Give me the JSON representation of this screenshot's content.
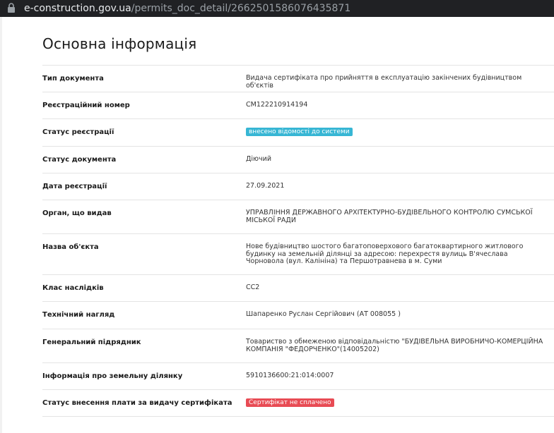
{
  "browser": {
    "url_host": "e-construction.gov.ua",
    "url_path": "/permits_doc_detail/2662501586076435871"
  },
  "page": {
    "title": "Основна інформація",
    "rows": [
      {
        "label": "Тип документа",
        "value": "Видача сертифіката про прийняття в експлуатацію закінчених будівництвом об'єктів"
      },
      {
        "label": "Реєстраційний номер",
        "value": "СМ122210914194"
      },
      {
        "label": "Статус реєстрації",
        "value": "внесено відомості до системи"
      },
      {
        "label": "Статус документа",
        "value": "Діючий"
      },
      {
        "label": "Дата реєстрації",
        "value": "27.09.2021"
      },
      {
        "label": "Орган, що видав",
        "value": "УПРАВЛІННЯ ДЕРЖАВНОГО АРХІТЕКТУРНО-БУДІВЕЛЬНОГО КОНТРОЛЮ СУМСЬКОЇ МІСЬКОЇ РАДИ"
      },
      {
        "label": "Назва об'єкта",
        "value": "Нове будівництво шостого багатоповерхового багатоквартирного житлового будинку на земельній ділянці за адресою: перехрестя вулиць В'ячеслава Чорновола (вул. Калініна) та Першотравнева в м. Суми"
      },
      {
        "label": "Клас наслідків",
        "value": "СС2"
      },
      {
        "label": "Технічний нагляд",
        "value": "Шапаренко Руслан Сергійович (АТ 008055 )"
      },
      {
        "label": "Генеральний підрядник",
        "value": "Товариство з обмеженою відповідальністю \"БУДІВЕЛЬНА ВИРОБНИЧО-КОМЕРЦІЙНА КОМПАНІЯ \"ФЕДОРЧЕНКО\"(14005202)"
      },
      {
        "label": "Інформація про земельну ділянку",
        "value": "5910136600:21:014:0007"
      },
      {
        "label": "Статус внесення плати за видачу сертифіката",
        "value": "Сертифікат не сплачено"
      }
    ]
  },
  "colors": {
    "badge_info": "#37b6d4",
    "badge_danger": "#e84b54"
  },
  "icons": {
    "address_bar": "lock-icon"
  }
}
